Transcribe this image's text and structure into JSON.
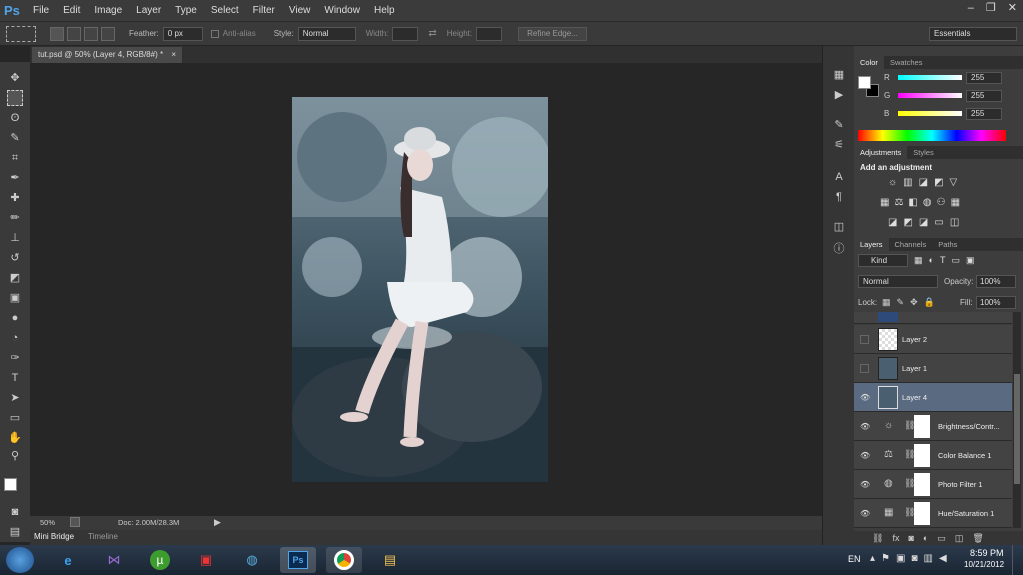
{
  "app": {
    "logo": "Ps"
  },
  "menu": [
    "File",
    "Edit",
    "Image",
    "Layer",
    "Type",
    "Select",
    "Filter",
    "View",
    "Window",
    "Help"
  ],
  "window_controls": [
    "–",
    "❐",
    "✕"
  ],
  "options": {
    "feather_label": "Feather:",
    "feather_value": "0 px",
    "antialias_label": "Anti-alias",
    "style_label": "Style:",
    "style_value": "Normal",
    "width_label": "Width:",
    "height_label": "Height:",
    "refine_edge": "Refine Edge...",
    "workspace": "Essentials"
  },
  "document": {
    "tab_title": "tut.psd @ 50% (Layer 4, RGB/8#) *",
    "close": "×"
  },
  "status": {
    "zoom": "50%",
    "doc_size": "Doc: 2.00M/28.3M"
  },
  "bottom_tabs": [
    "Mini Bridge",
    "Timeline"
  ],
  "color_panel": {
    "tabs": [
      "Color",
      "Swatches"
    ],
    "channels": [
      {
        "label": "R",
        "value": "255"
      },
      {
        "label": "G",
        "value": "255"
      },
      {
        "label": "B",
        "value": "255"
      }
    ]
  },
  "adjustments_panel": {
    "tabs": [
      "Adjustments",
      "Styles"
    ],
    "heading": "Add an adjustment"
  },
  "layers_panel": {
    "tabs": [
      "Layers",
      "Channels",
      "Paths"
    ],
    "kind_label": "Kind",
    "blend_mode": "Normal",
    "opacity_label": "Opacity:",
    "opacity_value": "100%",
    "lock_label": "Lock:",
    "fill_label": "Fill:",
    "fill_value": "100%",
    "layers": [
      {
        "name": "Layer 2"
      },
      {
        "name": "Layer 1"
      },
      {
        "name": "Layer 4"
      },
      {
        "name": "Brightness/Contr..."
      },
      {
        "name": "Color Balance 1"
      },
      {
        "name": "Photo Filter 1"
      },
      {
        "name": "Hue/Saturation 1"
      }
    ]
  },
  "taskbar": {
    "language": "EN",
    "time": "8:59 PM",
    "date": "10/21/2012"
  }
}
